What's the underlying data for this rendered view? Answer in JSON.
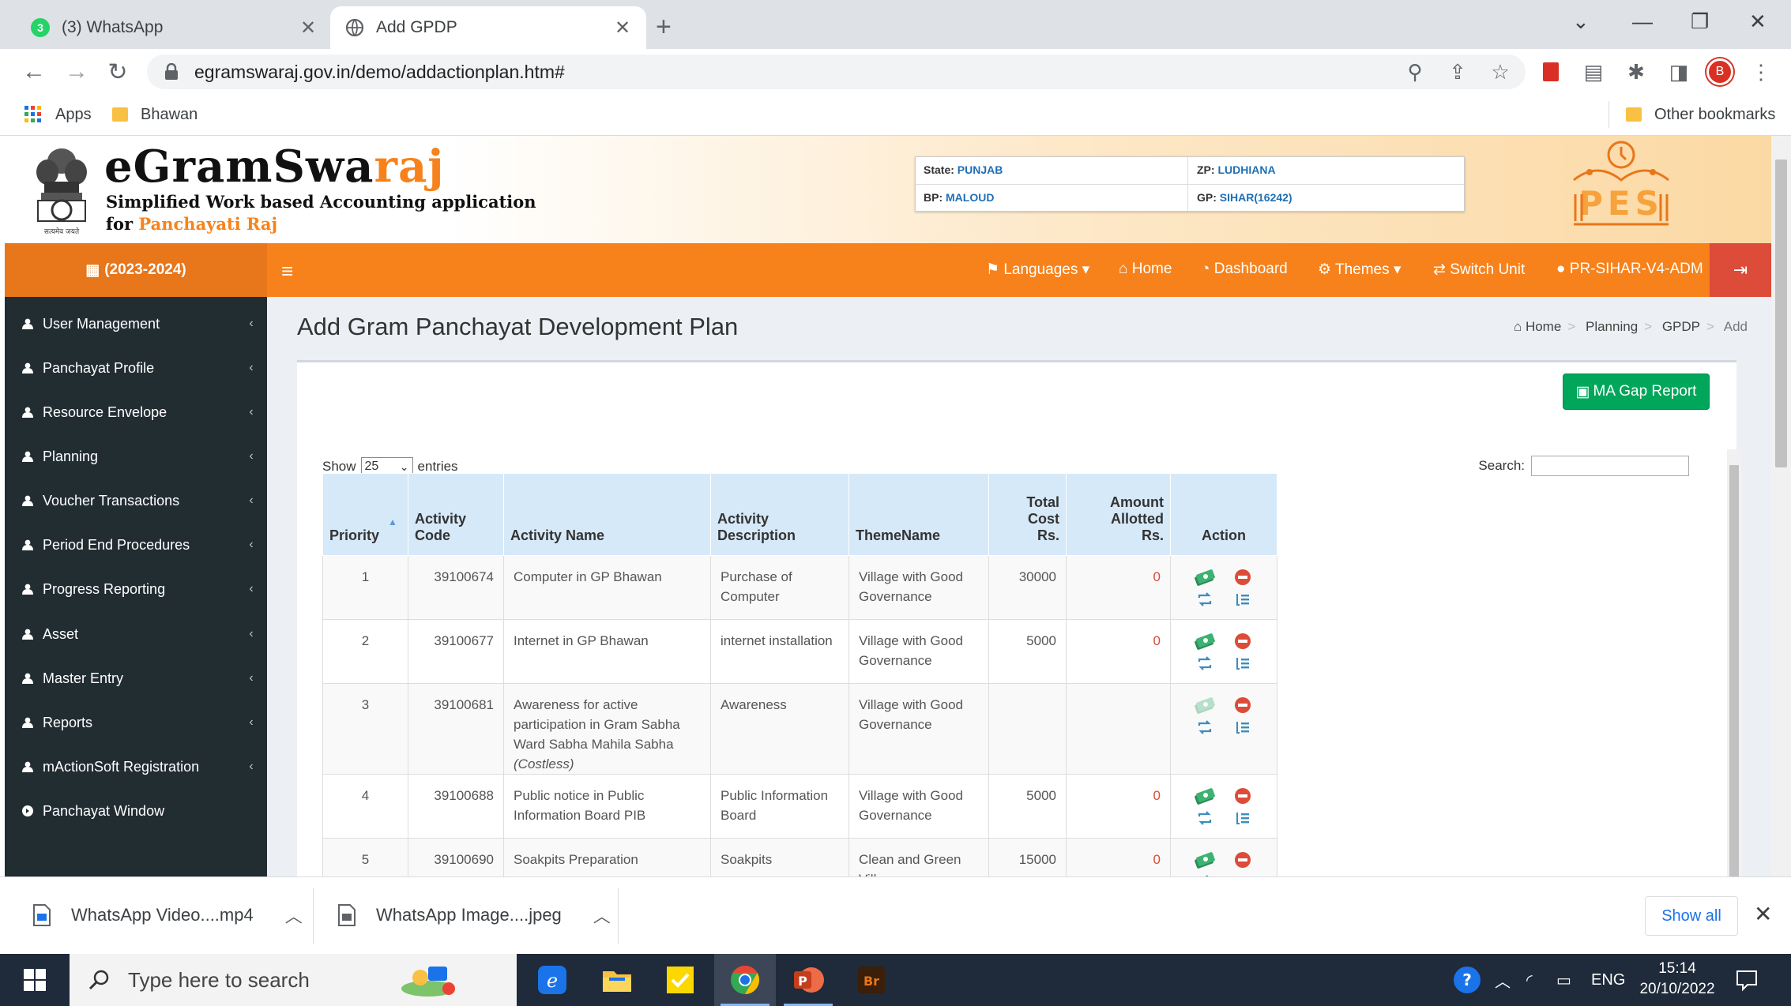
{
  "browser": {
    "tabs": [
      {
        "title": "(3) WhatsApp",
        "badge": "3"
      },
      {
        "title": "Add GPDP"
      }
    ],
    "url": "egramswaraj.gov.in/demo/addactionplan.htm#",
    "bookmarks": {
      "apps": "Apps",
      "bhawan": "Bhawan",
      "other": "Other bookmarks"
    },
    "profile_initial": "B"
  },
  "site": {
    "brand_main": "eGramSwa",
    "brand_accent": "raj",
    "tagline_line1": "Simplified Work based Accounting application",
    "tagline_for": "for ",
    "tagline_accent": "Panchayati Raj",
    "emblem_caption": "सत्यमेव जयते",
    "pes_label": "PES",
    "info": {
      "state_label": "State:",
      "state_value": "PUNJAB",
      "zp_label": "ZP:",
      "zp_value": "LUDHIANA",
      "bp_label": "BP:",
      "bp_value": "MALOUD",
      "gp_label": "GP:",
      "gp_value": "SIHAR(16242)"
    },
    "nav": {
      "year": "(2023-2024)",
      "languages": "Languages",
      "home": "Home",
      "dashboard": "Dashboard",
      "themes": "Themes",
      "switch_unit": "Switch Unit",
      "user": "PR-SIHAR-V4-ADM"
    },
    "sidebar": [
      {
        "label": "User Management",
        "chevron": "‹"
      },
      {
        "label": "Panchayat Profile",
        "chevron": "‹"
      },
      {
        "label": "Resource Envelope",
        "chevron": "‹"
      },
      {
        "label": "Planning",
        "chevron": "‹"
      },
      {
        "label": "Voucher Transactions",
        "chevron": "‹"
      },
      {
        "label": "Period End Procedures",
        "chevron": "‹"
      },
      {
        "label": "Progress Reporting",
        "chevron": "‹"
      },
      {
        "label": "Asset",
        "chevron": "‹"
      },
      {
        "label": "Master Entry",
        "chevron": "‹"
      },
      {
        "label": "Reports",
        "chevron": "‹"
      },
      {
        "label": "mActionSoft Registration",
        "chevron": "‹"
      },
      {
        "label": "Panchayat Window",
        "chevron": ""
      }
    ],
    "page_title": "Add Gram Panchayat Development Plan",
    "breadcrumb": [
      "Home",
      "Planning",
      "GPDP",
      "Add"
    ],
    "ma_gap_button": "MA Gap Report",
    "show_label": "Show",
    "entries_value": "25",
    "entries_label": "entries",
    "search_label": "Search:",
    "search_value": "",
    "table": {
      "headers": {
        "priority": "Priority",
        "code": "Activity Code",
        "name": "Activity Name",
        "desc": "Activity Description",
        "theme": "ThemeName",
        "cost_1": "Total",
        "cost_2": "Cost",
        "cost_3": "Rs.",
        "amt_1": "Amount",
        "amt_2": "Allotted",
        "amt_3": "Rs.",
        "action": "Action"
      },
      "rows": [
        {
          "priority": "1",
          "code": "39100674",
          "name": "Computer in GP Bhawan",
          "name_note": "",
          "desc": "Purchase of Computer",
          "theme": "Village with Good Governance",
          "cost": "30000",
          "allotted": "0",
          "money_faded": false
        },
        {
          "priority": "2",
          "code": "39100677",
          "name": "Internet in GP Bhawan",
          "name_note": "",
          "desc": "internet installation",
          "theme": "Village with Good Governance",
          "cost": "5000",
          "allotted": "0",
          "money_faded": false
        },
        {
          "priority": "3",
          "code": "39100681",
          "name": "Awareness for active participation in Gram Sabha Ward Sabha Mahila Sabha",
          "name_note": "(Costless)",
          "desc": "Awareness",
          "theme": "Village with Good Governance",
          "cost": "",
          "allotted": "",
          "money_faded": true
        },
        {
          "priority": "4",
          "code": "39100688",
          "name": "Public notice in Public Information Board PIB",
          "name_note": "",
          "desc": "Public Information Board",
          "theme": "Village with Good Governance",
          "cost": "5000",
          "allotted": "0",
          "money_faded": false
        },
        {
          "priority": "5",
          "code": "39100690",
          "name": "Soakpits Preparation",
          "name_note": "",
          "desc": "Soakpits",
          "theme": "Clean and Green Village",
          "cost": "15000",
          "allotted": "0",
          "money_faded": false
        }
      ]
    }
  },
  "downloads": {
    "items": [
      {
        "name": "WhatsApp Video....mp4"
      },
      {
        "name": "WhatsApp Image....jpeg"
      }
    ],
    "show_all": "Show all"
  },
  "taskbar": {
    "search_placeholder": "Type here to search",
    "lang": "ENG",
    "time": "15:14",
    "date": "20/10/2022"
  },
  "colors": {
    "accent": "#f7821b",
    "sidebar": "#222d32",
    "success": "#00a65a",
    "danger": "#dd4b39",
    "table_header": "#d6e9f8"
  }
}
